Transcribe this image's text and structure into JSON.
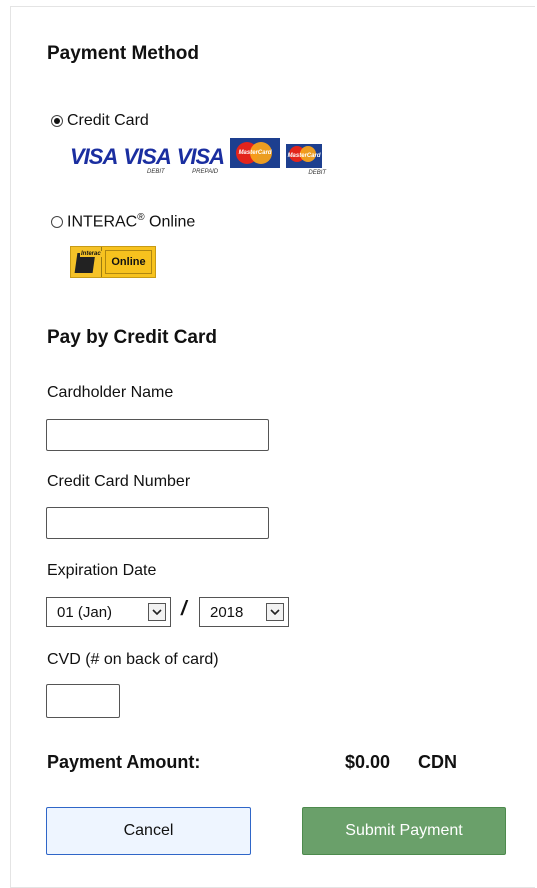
{
  "payment_method": {
    "heading": "Payment Method",
    "credit_card_label": "Credit Card",
    "credit_card_selected": true,
    "interac_label": "INTERAC",
    "interac_sup": "®",
    "interac_suffix": " Online",
    "interac_selected": false,
    "logos": {
      "visa": "VISA",
      "visa_debit": "VISA",
      "visa_debit_sub": "DEBIT",
      "visa_prepaid": "VISA",
      "visa_prepaid_sub": "PREPAID",
      "mastercard": "MasterCard",
      "mastercard_debit": "MasterCard",
      "mastercard_debit_sub": "DEBIT",
      "interac_logo_text": "Interac",
      "interac_online_text": "Online"
    }
  },
  "credit_form": {
    "heading": "Pay by Credit Card",
    "cardholder_label": "Cardholder Name",
    "cardholder_value": "",
    "card_number_label": "Credit Card Number",
    "card_number_value": "",
    "expiration_label": "Expiration Date",
    "month_value": "01 (Jan)",
    "separator": "/",
    "year_value": "2018",
    "cvd_label": "CVD (# on back of card)",
    "cvd_value": ""
  },
  "summary": {
    "amount_label": "Payment Amount:",
    "amount_value": "$0.00",
    "currency": "CDN"
  },
  "actions": {
    "cancel_label": "Cancel",
    "submit_label": "Submit Payment"
  },
  "colors": {
    "submit_bg": "#6aa06a",
    "cancel_border": "#2f66c8",
    "cancel_bg": "#eef5ff",
    "visa_blue": "#1a2ea0",
    "interac_yellow": "#f7c21e"
  }
}
